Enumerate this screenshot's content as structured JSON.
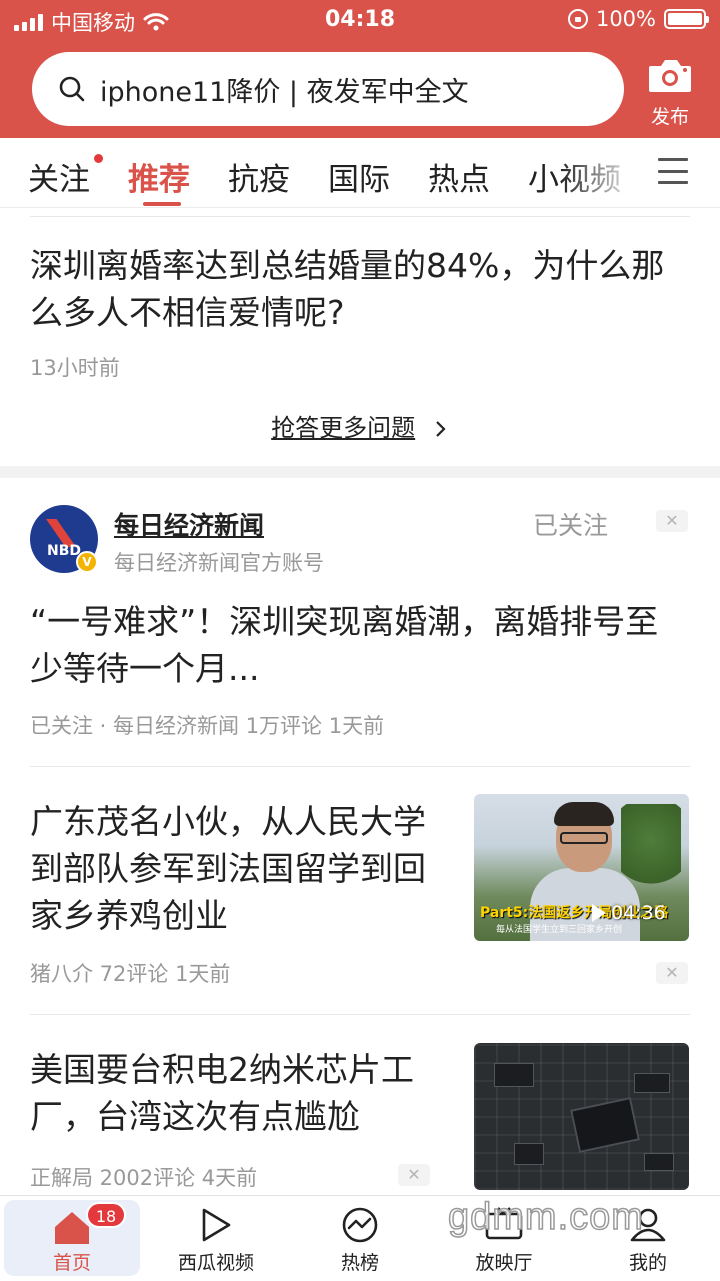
{
  "status_bar": {
    "carrier": "中国移动",
    "time": "04:18",
    "battery": "100%",
    "battery_level": 1.0
  },
  "header": {
    "search_text": "iphone11降价 | 夜发军中全文",
    "publish_label": "发布"
  },
  "tabs": [
    {
      "label": "关注",
      "active": false,
      "has_dot": true
    },
    {
      "label": "推荐",
      "active": true
    },
    {
      "label": "抗疫",
      "active": false
    },
    {
      "label": "国际",
      "active": false
    },
    {
      "label": "热点",
      "active": false
    },
    {
      "label": "小视频",
      "active": false
    }
  ],
  "qa_card": {
    "title": "深圳离婚率达到总结婚量的84%，为什么那么多人不相信爱情呢?",
    "time": "13小时前",
    "more_answers": "抢答更多问题"
  },
  "account_card": {
    "avatar_text": "NBD",
    "author": "每日经济新闻",
    "author_desc": "每日经济新闻官方账号",
    "follow_status": "已关注",
    "title": "“一号难求”！深圳突现离婚潮，离婚排号至少等待一个月...",
    "meta": "已关注 · 每日经济新闻  1万评论  1天前"
  },
  "articles": [
    {
      "title": "广东茂名小伙，从人民大学到部队参军到法国留学到回家乡养鸡创业",
      "meta": "猪八介  72评论  1天前",
      "thumb_caption": "Part5:法国返乡开局创业之路",
      "thumb_subcaption": "毎从法国学生立到三回家乡开创",
      "duration": "04:36"
    },
    {
      "title": "美国要台积电2纳米芯片工厂，台湾这次有点尴尬",
      "meta": "正解局  2002评论  4天前"
    }
  ],
  "bottom_nav": [
    {
      "label": "首页",
      "active": true,
      "badge": "18"
    },
    {
      "label": "西瓜视频",
      "active": false
    },
    {
      "label": "热榜",
      "active": false
    },
    {
      "label": "放映厅",
      "active": false
    },
    {
      "label": "我的",
      "active": false
    }
  ],
  "watermark": "gdmm.com",
  "colors": {
    "brand_red": "#d9534a",
    "badge_red": "#e4393c",
    "meta_gray": "#999999"
  }
}
